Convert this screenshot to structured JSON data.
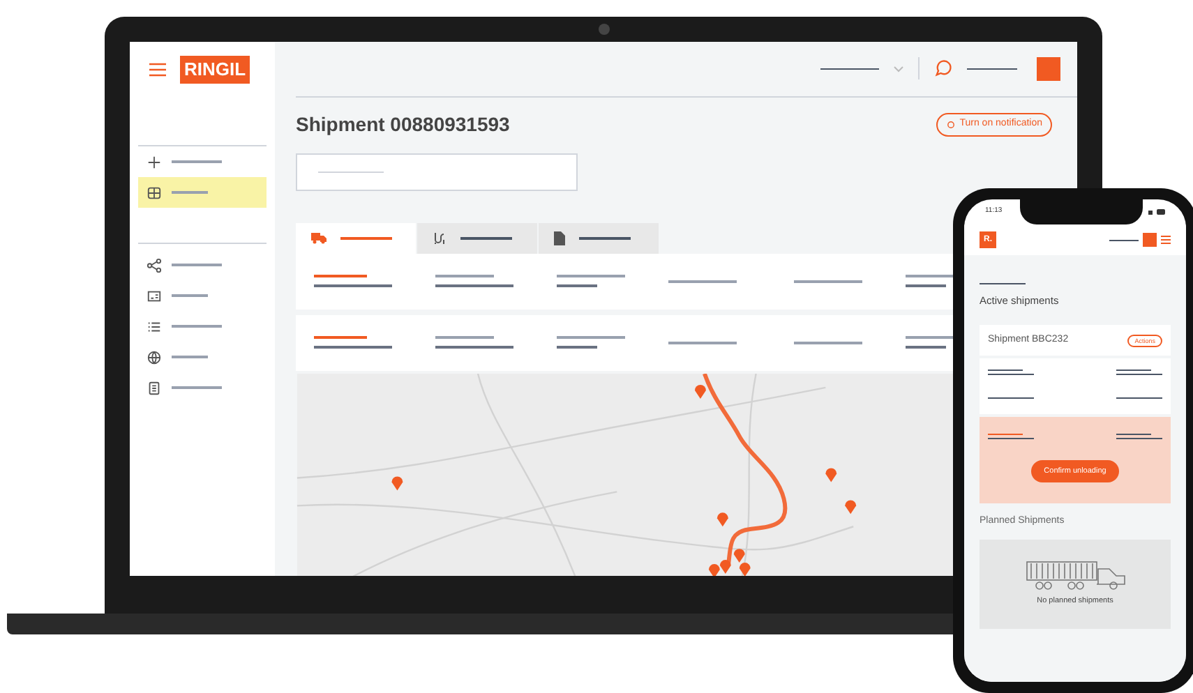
{
  "laptop": {
    "logo": "RINGIL",
    "sidebar": {
      "items": [
        {
          "selected": false
        },
        {
          "selected": true
        },
        {
          "selected": false
        },
        {
          "selected": false
        },
        {
          "selected": false
        },
        {
          "selected": false
        },
        {
          "selected": false
        }
      ]
    },
    "title": "Shipment 00880931593",
    "notification_button": "Turn on notification",
    "tabs": [
      {
        "selected": true
      },
      {
        "selected": false
      },
      {
        "selected": false
      }
    ]
  },
  "phone": {
    "time": "11:13",
    "logo": "R.",
    "section_title": "Active shipments",
    "shipment": "Shipment BBC232",
    "actions_button": "Actions",
    "confirm_button": "Confirm unloading",
    "planned_title": "Planned Shipments",
    "empty_text": "No planned shipments"
  }
}
